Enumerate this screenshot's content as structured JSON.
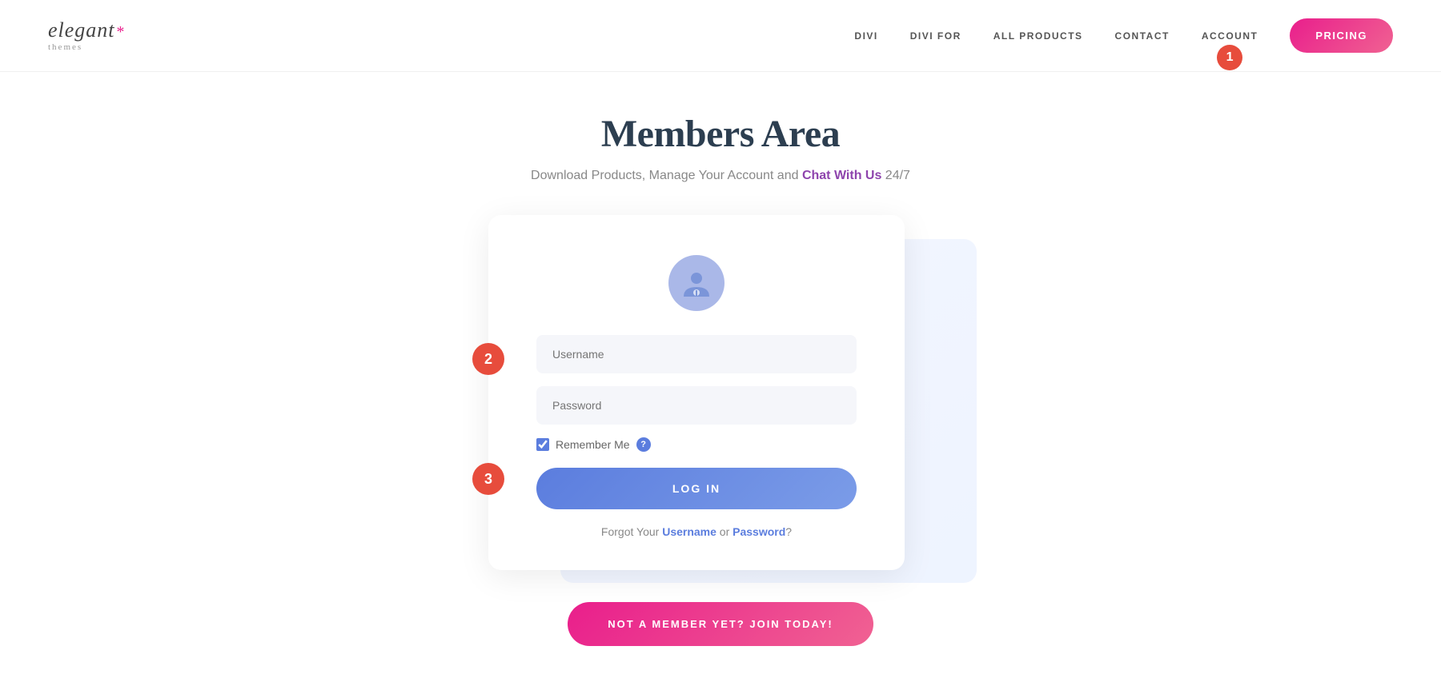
{
  "header": {
    "logo": {
      "brand": "elegant",
      "star": "*",
      "sub": "themes"
    },
    "nav": {
      "items": [
        {
          "id": "divi",
          "label": "DIVI"
        },
        {
          "id": "divi-for",
          "label": "DIVI FOR"
        },
        {
          "id": "all-products",
          "label": "ALL PRODUCTS"
        },
        {
          "id": "contact",
          "label": "CONTACT"
        },
        {
          "id": "account",
          "label": "ACCOUNT"
        }
      ],
      "account_badge": "1",
      "pricing_label": "PRICING"
    }
  },
  "main": {
    "title": "Members Area",
    "subtitle_prefix": "Download Products, Manage Your Account and ",
    "subtitle_link": "Chat With Us",
    "subtitle_suffix": " 24/7"
  },
  "login_card": {
    "username_placeholder": "Username",
    "password_placeholder": "Password",
    "remember_label": "Remember Me",
    "help_icon": "?",
    "login_btn": "LOG IN",
    "forgot_prefix": "Forgot Your ",
    "forgot_username": "Username",
    "forgot_or": " or ",
    "forgot_password": "Password",
    "forgot_suffix": "?",
    "badge_2": "2",
    "badge_3": "3"
  },
  "join_btn": "NOT A MEMBER YET? JOIN TODAY!"
}
